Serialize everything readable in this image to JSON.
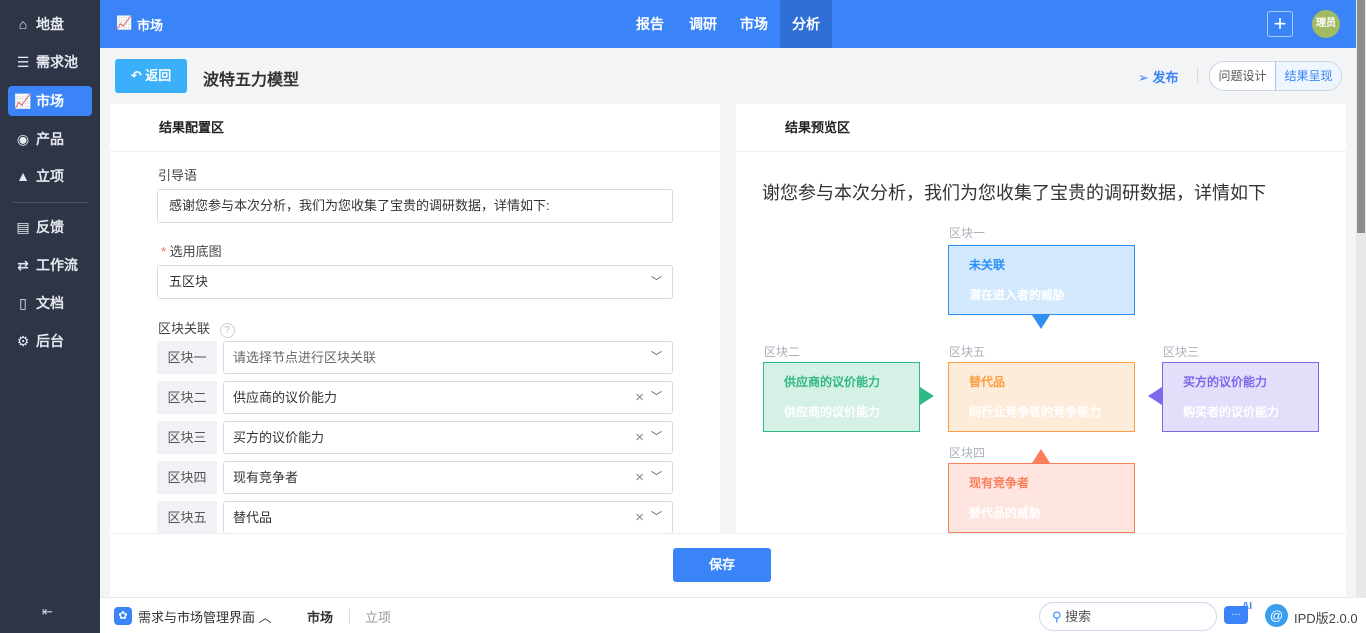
{
  "sidebar": {
    "items": [
      {
        "label": "地盘",
        "icon": "home-icon"
      },
      {
        "label": "需求池",
        "icon": "list-icon"
      },
      {
        "label": "市场",
        "icon": "chart-icon",
        "active": true
      },
      {
        "label": "产品",
        "icon": "bulb-icon"
      },
      {
        "label": "立项",
        "icon": "rocket-icon"
      },
      {
        "label": "反馈",
        "icon": "inbox-icon"
      },
      {
        "label": "工作流",
        "icon": "workflow-icon"
      },
      {
        "label": "文档",
        "icon": "document-icon"
      },
      {
        "label": "后台",
        "icon": "gear-icon"
      }
    ]
  },
  "topbar": {
    "module": "市场",
    "nav": [
      "报告",
      "调研",
      "市场",
      "分析"
    ],
    "active_nav": "分析",
    "avatar": "理员"
  },
  "header": {
    "back": "返回",
    "title": "波特五力模型",
    "publish": "发布",
    "tabs": [
      "问题设计",
      "结果呈现"
    ],
    "active_tab": "结果呈现"
  },
  "config": {
    "title": "结果配置区",
    "intro_label": "引导语",
    "intro_value": "感谢您参与本次分析，我们为您收集了宝贵的调研数据，详情如下:",
    "base_label": "选用底图",
    "base_value": "五区块",
    "assoc_label": "区块关联",
    "rows": [
      {
        "label": "区块一",
        "value": "请选择节点进行区块关联",
        "placeholder": true
      },
      {
        "label": "区块二",
        "value": "供应商的议价能力"
      },
      {
        "label": "区块三",
        "value": "买方的议价能力"
      },
      {
        "label": "区块四",
        "value": "现有竞争者"
      },
      {
        "label": "区块五",
        "value": "替代品"
      }
    ],
    "save": "保存"
  },
  "preview": {
    "title": "结果预览区",
    "heading": "谢您参与本次分析，我们为您收集了宝贵的调研数据，详情如下",
    "blocks": {
      "b1": {
        "label": "区块一",
        "t1": "未关联",
        "t2": "潜在进入者的威胁"
      },
      "b2": {
        "label": "区块二",
        "t1": "供应商的议价能力",
        "t2": "供应商的议价能力"
      },
      "b3": {
        "label": "区块三",
        "t1": "买方的议价能力",
        "t2": "购买者的议价能力"
      },
      "b4": {
        "label": "区块四",
        "t1": "现有竞争者",
        "t2": "替代品的威胁"
      },
      "b5": {
        "label": "区块五",
        "t1": "替代品",
        "t2": "同行业竞争者的竞争能力"
      }
    }
  },
  "bottom": {
    "app": "需求与市场管理界面",
    "crumbs": [
      "市场",
      "立项"
    ],
    "search_placeholder": "搜索",
    "ai": "AI",
    "version": "IPD版2.0.0"
  }
}
